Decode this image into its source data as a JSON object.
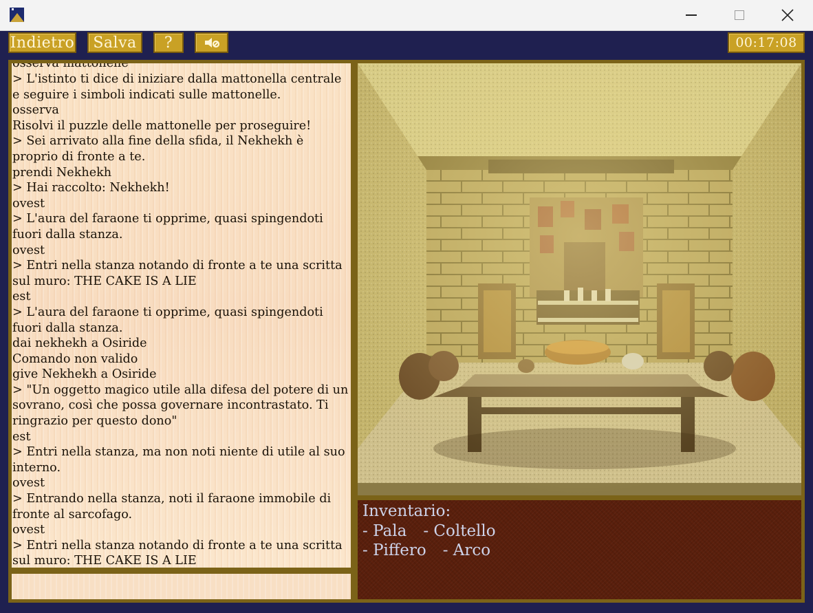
{
  "window": {
    "icon": "pyramid-app-icon",
    "controls": [
      "minimize-icon",
      "maximize-icon",
      "close-icon"
    ]
  },
  "toolbar": {
    "back_label": "Indietro",
    "save_label": "Salva",
    "help_label": "?",
    "sound_icon": "speaker-muted-icon",
    "timer": "00:17:08"
  },
  "log": {
    "lines": [
      "osserva mattonelle",
      "> L'istinto ti dice di iniziare dalla mattonella centrale e seguire i simboli indicati sulle mattonelle.",
      "osserva",
      "Risolvi il puzzle delle mattonelle per proseguire!",
      "> Sei arrivato alla fine della sfida, il Nekhekh è proprio di fronte a te.",
      "prendi Nekhekh",
      "> Hai raccolto: Nekhekh!",
      "ovest",
      "> L'aura del faraone ti opprime, quasi spingendoti fuori dalla stanza.",
      "ovest",
      "> Entri nella stanza notando di fronte a te una scritta sul muro: THE CAKE IS A LIE",
      "est",
      "> L'aura del faraone ti opprime, quasi spingendoti fuori dalla stanza.",
      "dai nekhekh a Osiride",
      "Comando non valido",
      "give Nekhekh a Osiride",
      "> \"Un oggetto magico utile alla difesa del potere di un sovrano, così che possa governare incontrastato. Ti ringrazio per questo dono\"",
      "est",
      "> Entri nella stanza, ma non noti niente di utile al suo interno.",
      "ovest",
      "> Entrando nella stanza, noti il faraone immobile di fronte al sarcofago.",
      "ovest",
      "> Entri nella stanza notando di fronte a te una scritta sul muro: THE CAKE IS A LIE"
    ]
  },
  "command": {
    "value": ""
  },
  "inventory": {
    "title": "Inventario:",
    "items": [
      "- Pala",
      "- Coltello",
      "- Piffero",
      "- Arco"
    ]
  },
  "colors": {
    "frame": "#1f2050",
    "button": "#c9a125",
    "border": "#7b6318",
    "log_bg": "#fae3c6",
    "inventory_bg": "#5a1f0c",
    "inventory_text": "#cdd3ea"
  }
}
